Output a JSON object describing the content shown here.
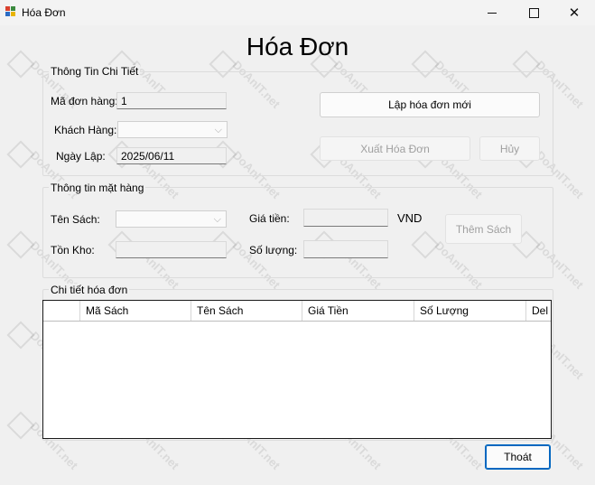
{
  "window": {
    "title": "Hóa Đơn"
  },
  "heading": "Hóa Đơn",
  "invoice_group": {
    "title": "Thông Tin Chi Tiết",
    "order_id_label": "Mã đơn hàng:",
    "order_id_value": "1",
    "customer_label": "Khách Hàng:",
    "customer_value": "",
    "date_label": "Ngày Lập:",
    "date_value": "2025/06/11",
    "new_invoice_button": "Lập hóa đơn mới",
    "export_button": "Xuất Hóa Đơn",
    "cancel_button": "Hủy"
  },
  "item_group": {
    "title": "Thông tin mặt hàng",
    "book_label": "Tên Sách:",
    "book_value": "",
    "price_label": "Giá tiền:",
    "price_value": "",
    "currency": "VND",
    "stock_label": "Tồn Kho:",
    "stock_value": "",
    "quantity_label": "Số lượng:",
    "quantity_value": "",
    "add_book_button": "Thêm Sách"
  },
  "details_group": {
    "title": "Chi tiết hóa đơn",
    "columns": [
      "Mã Sách",
      "Tên Sách",
      "Giá Tiền",
      "Số Lượng",
      "Del"
    ],
    "rows": []
  },
  "exit_button": "Thoát",
  "watermark": "DoAnIT.net",
  "colors": {
    "accent": "#0067c0",
    "background": "#f0f0f0"
  }
}
